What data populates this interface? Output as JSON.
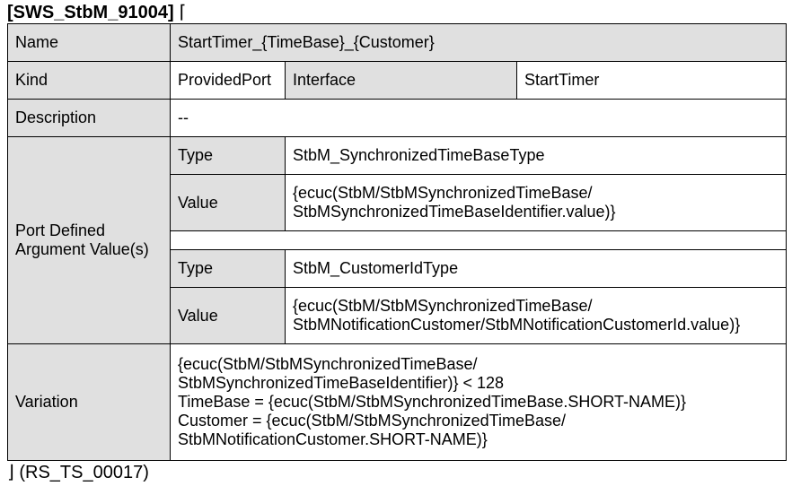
{
  "header": {
    "id": "[SWS_StbM_91004]",
    "open_mark": "⌈"
  },
  "footer": {
    "text": "⌋ (RS_TS_00017)"
  },
  "rows": {
    "name": {
      "label": "Name",
      "value": "StartTimer_{TimeBase}_{Customer}"
    },
    "kind": {
      "label": "Kind",
      "port": "ProvidedPort",
      "type": "Interface",
      "interface": "StartTimer"
    },
    "description": {
      "label": "Description",
      "value": "--"
    },
    "port_args": {
      "label_line1": "Port Defined",
      "label_line2": "Argument Value(s)",
      "arg1": {
        "type_label": "Type",
        "type_value": "StbM_SynchronizedTimeBaseType",
        "value_label": "Value",
        "value_line1": "{ecuc(StbM/StbMSynchronizedTimeBase/",
        "value_line2": "StbMSynchronizedTimeBaseIdentifier.value)}"
      },
      "arg2": {
        "type_label": "Type",
        "type_value": "StbM_CustomerIdType",
        "value_label": "Value",
        "value_line1": "{ecuc(StbM/StbMSynchronizedTimeBase/",
        "value_line2": "StbMNotificationCustomer/StbMNotificationCustomerId.value)}"
      }
    },
    "variation": {
      "label": "Variation",
      "lines": [
        "{ecuc(StbM/StbMSynchronizedTimeBase/",
        "StbMSynchronizedTimeBaseIdentifier)} < 128",
        "TimeBase = {ecuc(StbM/StbMSynchronizedTimeBase.SHORT-NAME)}",
        "Customer = {ecuc(StbM/StbMSynchronizedTimeBase/",
        "StbMNotificationCustomer.SHORT-NAME)}"
      ]
    }
  }
}
